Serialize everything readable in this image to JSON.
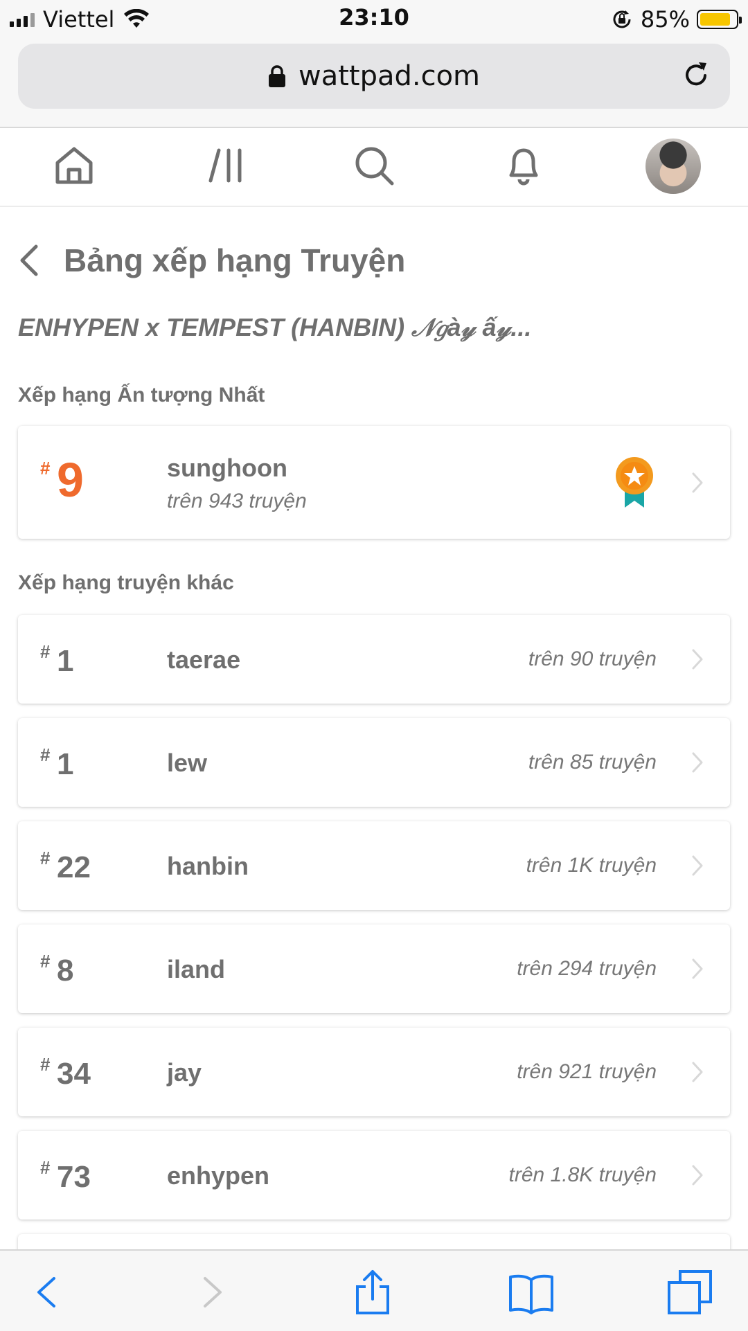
{
  "status_bar": {
    "carrier": "Viettel",
    "time": "23:10",
    "battery_percent": "85%",
    "battery_level": 0.85,
    "battery_color": "#f7c600"
  },
  "browser": {
    "url": "wattpad.com",
    "lock_icon": "lock-icon",
    "reload_icon": "reload-icon"
  },
  "app_nav": {
    "items": [
      {
        "icon": "home-icon"
      },
      {
        "icon": "library-icon"
      },
      {
        "icon": "search-icon"
      },
      {
        "icon": "bell-icon"
      },
      {
        "icon": "avatar"
      }
    ]
  },
  "page": {
    "title": "Bảng xếp hạng Truyện",
    "story_title": "ENHYPEN x TEMPEST (HANBIN) 𝒩𝑔à𝓎 ấ𝓎...",
    "accent_color": "#ef6a2d"
  },
  "top_ranking": {
    "section_label": "Xếp hạng Ấn tượng Nhất",
    "hash": "#",
    "rank": "9",
    "tag": "sunghoon",
    "subtitle": "trên 943 truyện",
    "badge_icon": "medal-icon"
  },
  "other_rankings": {
    "section_label": "Xếp hạng truyện khác",
    "items": [
      {
        "hash": "#",
        "rank": "1",
        "tag": "taerae",
        "count": "trên 90 truyện"
      },
      {
        "hash": "#",
        "rank": "1",
        "tag": "lew",
        "count": "trên 85 truyện"
      },
      {
        "hash": "#",
        "rank": "22",
        "tag": "hanbin",
        "count": "trên 1K truyện"
      },
      {
        "hash": "#",
        "rank": "8",
        "tag": "iland",
        "count": "trên 294 truyện"
      },
      {
        "hash": "#",
        "rank": "34",
        "tag": "jay",
        "count": "trên 921 truyện"
      },
      {
        "hash": "#",
        "rank": "73",
        "tag": "enhypen",
        "count": "trên 1.8K truyện"
      }
    ]
  },
  "safari_toolbar": {
    "items": [
      "back-icon",
      "forward-icon",
      "share-icon",
      "bookmarks-icon",
      "tabs-icon"
    ],
    "accent_color": "#1a7cf0"
  }
}
